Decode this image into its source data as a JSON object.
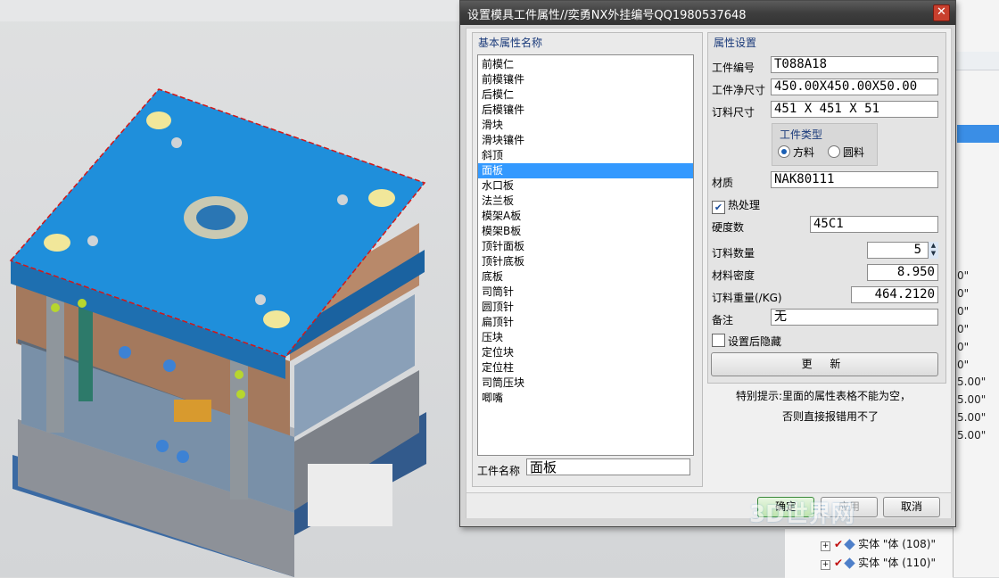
{
  "dialog": {
    "title": "设置模具工件属性//奕勇NX外挂编号QQ1980537648",
    "close": "✕",
    "left_group_title": "基本属性名称",
    "parts": [
      "前模仁",
      "前模镶件",
      "后模仁",
      "后模镶件",
      "滑块",
      "滑块镶件",
      "斜顶",
      "面板",
      "水口板",
      "法兰板",
      "模架A板",
      "模架B板",
      "顶针面板",
      "顶针底板",
      "底板",
      "司筒针",
      "圆顶针",
      "扁顶针",
      "压块",
      "定位块",
      "定位柱",
      "司筒压块",
      "唧嘴"
    ],
    "selected_part": "面板",
    "part_name_label": "工件名称",
    "part_name_value": "面板",
    "right_group_title": "属性设置",
    "part_no_label": "工件编号",
    "part_no_value": "T088A18",
    "net_size_label": "工件净尺寸",
    "net_size_value": "450.00X450.00X50.00",
    "order_size_label": "订料尺寸",
    "order_size_value": "451 X 451 X 51",
    "type_title": "工件类型",
    "type_square": "方料",
    "type_round": "圆料",
    "type_selected": "方料",
    "material_label": "材质",
    "material_value": "NAK80111",
    "heat_treat_label": "热处理",
    "heat_treat_checked": true,
    "hardness_label": "硬度数",
    "hardness_value": "45C1",
    "qty_label": "订料数量",
    "qty_value": "5",
    "density_label": "材料密度",
    "density_value": "8.950",
    "weight_label": "订料重量(/KG)",
    "weight_value": "464.2120",
    "remark_label": "备注",
    "remark_value": "无",
    "hide_after_label": "设置后隐藏",
    "hide_after_checked": false,
    "update_label": "更 新",
    "hint_line1": "特别提示:里面的属性表格不能为空，",
    "hint_line2": "否则直接报错用不了",
    "ok_label": "确定",
    "apply_label": "应用",
    "cancel_label": "取消"
  },
  "navigator": {
    "rows": [
      "0\"",
      "0\"",
      "0\"",
      "0\"",
      "0\"",
      "0\"",
      "5.00\"",
      "5.00\"",
      "5.00\"",
      "5.00\""
    ],
    "tree": [
      "实体 \"体 (108)\"",
      "实体 \"体 (110)\""
    ]
  },
  "watermark": "3D世界网",
  "colors": {
    "accent": "#3399ff",
    "mold_blue": "#1f8fdb",
    "titlebar": "#3e3e3e"
  }
}
